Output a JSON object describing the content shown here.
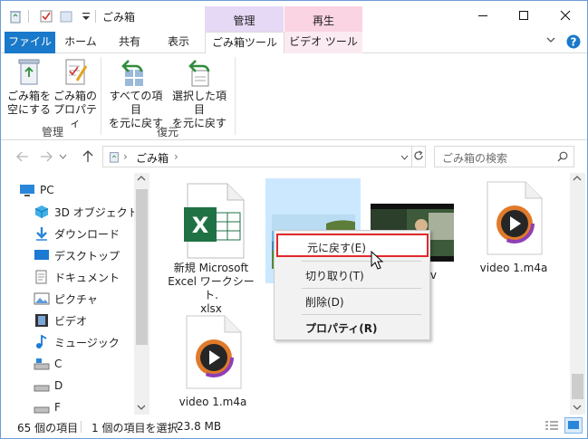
{
  "window": {
    "title": "ごみ箱",
    "context_group_manage": "管理",
    "context_group_play": "再生"
  },
  "tabs": {
    "file": "ファイル",
    "home": "ホーム",
    "share": "共有",
    "view": "表示",
    "recycle_tools": "ごみ箱ツール",
    "video_tools": "ビデオ ツール"
  },
  "ribbon": {
    "empty_bin_line1": "ごみ箱を",
    "empty_bin_line2": "空にする",
    "properties_line1": "ごみ箱の",
    "properties_line2": "プロパティ",
    "restore_all_line1": "すべての項目",
    "restore_all_line2": "を元に戻す",
    "restore_sel_line1": "選択した項目",
    "restore_sel_line2": "を元に戻す",
    "group_manage": "管理",
    "group_restore": "復元"
  },
  "address": {
    "crumb": "ごみ箱",
    "search_placeholder": "ごみ箱の検索"
  },
  "navpane": {
    "items": [
      "PC",
      "3D オブジェクト",
      "ダウンロード",
      "デスクトップ",
      "ドキュメント",
      "ピクチャ",
      "ビデオ",
      "ミュージック",
      "C",
      "D",
      "F"
    ]
  },
  "files": {
    "excel_line1": "新規 Microsoft",
    "excel_line2": "Excel ワークシート.",
    "excel_line3": "xlsx",
    "mkv_partial": "kv",
    "m4a_1": "video 1.m4a",
    "m4a_2": "video 1.m4a"
  },
  "status": {
    "item_count": "65 個の項目",
    "selection": "1 個の項目を選択",
    "size": "23.8 MB"
  },
  "context_menu": {
    "restore": "元に戻す(E)",
    "cut": "切り取り(T)",
    "delete": "削除(D)",
    "properties": "プロパティ(R)"
  },
  "colors": {
    "accent": "#1979ca",
    "highlight_border": "#e0282e",
    "selection": "#cce8ff",
    "excel_green": "#1f7244"
  }
}
